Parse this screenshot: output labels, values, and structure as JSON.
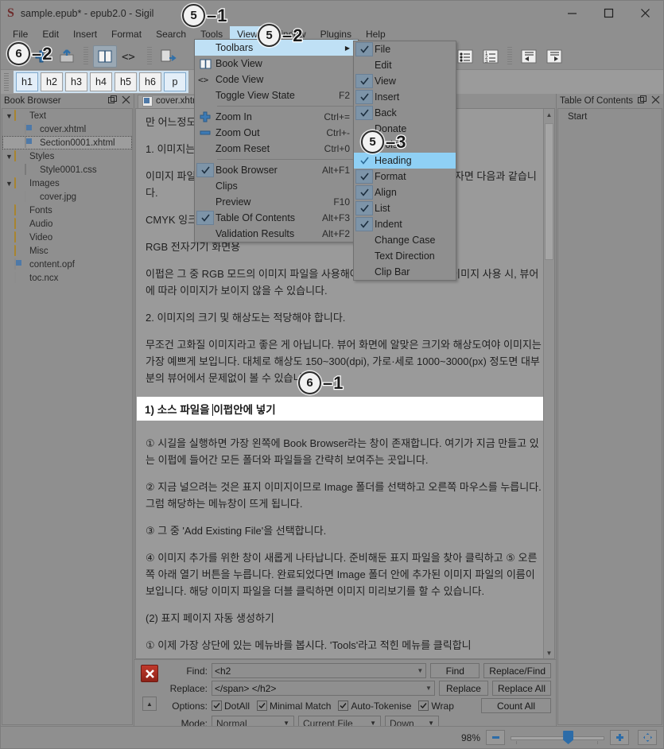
{
  "window": {
    "title": "sample.epub* - epub2.0 - Sigil",
    "logo": "S",
    "minimize": "minimize-icon",
    "maximize": "maximize-icon",
    "close": "close-icon"
  },
  "menubar": {
    "items": [
      {
        "label": "File"
      },
      {
        "label": "Edit"
      },
      {
        "label": "Insert"
      },
      {
        "label": "Format"
      },
      {
        "label": "Search"
      },
      {
        "label": "Tools"
      },
      {
        "label": "View",
        "active": true
      },
      {
        "label": "Window"
      },
      {
        "label": "Plugins"
      },
      {
        "label": "Help"
      }
    ]
  },
  "heading_toolbar": {
    "buttons": [
      "h1",
      "h2",
      "h3",
      "h4",
      "h5",
      "h6",
      "p"
    ],
    "selected": "p"
  },
  "view_menu": {
    "items": [
      {
        "label": "Toolbars",
        "submenu": true,
        "highlighted": true
      },
      {
        "label": "Book View",
        "icon": "book-icon"
      },
      {
        "label": "Code View",
        "icon": "code-icon"
      },
      {
        "label": "Toggle View State",
        "accel": "F2"
      },
      {
        "separator": true
      },
      {
        "label": "Zoom In",
        "accel": "Ctrl+=",
        "icon": "plus-icon"
      },
      {
        "label": "Zoom Out",
        "accel": "Ctrl+-",
        "icon": "minus-icon"
      },
      {
        "label": "Zoom Reset",
        "accel": "Ctrl+0"
      },
      {
        "separator": true
      },
      {
        "label": "Book Browser",
        "accel": "Alt+F1",
        "checked": true
      },
      {
        "label": "Clips"
      },
      {
        "label": "Preview",
        "accel": "F10"
      },
      {
        "label": "Table Of Contents",
        "accel": "Alt+F3",
        "checked": true
      },
      {
        "label": "Validation Results",
        "accel": "Alt+F2"
      }
    ]
  },
  "toolbars_submenu": {
    "items": [
      {
        "label": "File",
        "checked": true,
        "boxed": true
      },
      {
        "label": "Edit",
        "checked": false
      },
      {
        "label": "View",
        "checked": true
      },
      {
        "label": "Insert",
        "checked": true
      },
      {
        "label": "Back",
        "checked": true
      },
      {
        "label": "Donate",
        "checked": false
      },
      {
        "label": "Tools",
        "checked": false
      },
      {
        "label": "Heading",
        "checked": true,
        "highlighted": true
      },
      {
        "label": "Format",
        "checked": true
      },
      {
        "label": "Align",
        "checked": true
      },
      {
        "label": "List",
        "checked": true
      },
      {
        "label": "Indent",
        "checked": true
      },
      {
        "label": "Change Case",
        "checked": false
      },
      {
        "label": "Text Direction",
        "checked": false
      },
      {
        "label": "Clip Bar",
        "checked": false
      }
    ]
  },
  "book_browser": {
    "title": "Book Browser",
    "float_icon": "float-icon",
    "close_icon": "close-icon",
    "tree": [
      {
        "label": "Text",
        "type": "folder",
        "depth": 0,
        "expanded": true
      },
      {
        "label": "cover.xhtml",
        "type": "xhtml",
        "depth": 1
      },
      {
        "label": "Section0001.xhtml",
        "type": "xhtml",
        "depth": 1,
        "selected": true
      },
      {
        "label": "Styles",
        "type": "folder",
        "depth": 0,
        "expanded": true
      },
      {
        "label": "Style0001.css",
        "type": "css",
        "depth": 1
      },
      {
        "label": "Images",
        "type": "folder",
        "depth": 0,
        "expanded": true
      },
      {
        "label": "cover.jpg",
        "type": "doc",
        "depth": 1
      },
      {
        "label": "Fonts",
        "type": "folder",
        "depth": 0
      },
      {
        "label": "Audio",
        "type": "folder",
        "depth": 0
      },
      {
        "label": "Video",
        "type": "folder",
        "depth": 0
      },
      {
        "label": "Misc",
        "type": "folder",
        "depth": 0
      },
      {
        "label": "content.opf",
        "type": "xhtml",
        "depth": 0
      },
      {
        "label": "toc.ncx",
        "type": "doc",
        "depth": 0
      }
    ]
  },
  "editor": {
    "tab_label": "cover.xhtml",
    "paragraphs": [
      "만 어느정도 지켜주어야 다양한 뷰어에서 문제없이 볼 수 있습니다.",
      "1. 이미지는 RGB 모드여야 합니다.",
      "이미지 파일은 크게 RGB 모드와 CMYK 모드로 나뉩니다. 간단히 설명하자면 다음과 같습니다.",
      "CMYK 잉크를 사용하는 인쇄용",
      "RGB 전자기기 화면용",
      "이펍은 그 중 RGB 모드의 이미지 파일을 사용해야 합니다. CMYK 모드 이미지 사용 시, 뷰어에 따라 이미지가 보이지 않을 수 있습니다.",
      "2. 이미지의 크기 및 해상도는 적당해야 합니다.",
      "무조건 고화질 이미지라고 좋은 게 아닙니다. 뷰어 화면에 알맞은 크기와 해상도여야 이미지는 가장 예쁘게 보입니다. 대체로 해상도 150~300(dpi), 가로·세로 1000~3000(px) 정도면 대부분의 뷰어에서 문제없이 볼 수 있습니다."
    ],
    "heading_line_before": "1) 소스 파일을 ",
    "heading_line_after": "이펍안에 넣기",
    "paragraphs_after": [
      "① 시길을 실행하면 가장 왼쪽에 Book Browser라는 창이 존재합니다. 여기가 지금 만들고 있는 이펍에 들어간 모든 폴더와 파일들을 간략히 보여주는 곳입니다.",
      "② 지금 널으려는 것은 표지 이미지이므로 Image 폴더를 선택하고 오른쪽 마우스를 누릅니다. 그럼 해당하는 메뉴창이 뜨게 됩니다.",
      "③ 그 중 'Add Existing File'을 선택합니다.",
      "④ 이미지 추가를 위한 창이 새롭게 나타납니다. 준비해둔 표지 파일을 찾아 클릭하고 ⑤ 오른쪽 아래 열기 버튼을 누릅니다. 완료되었다면 Image 폴더 안에 추가된 이미지 파일의 이름이 보입니다. 해당 이미지 파일을 더블 클릭하면 이미지 미리보기를 할 수 있습니다.",
      "(2) 표지 페이지 자동 생성하기",
      "① 이제 가장 상단에 있는 메뉴바를 봅시다. 'Tools'라고 적힌 메뉴를 클릭합니"
    ]
  },
  "toc": {
    "title": "Table Of Contents",
    "float_icon": "float-icon",
    "close_icon": "close-icon",
    "entries": [
      "Start"
    ]
  },
  "find_replace": {
    "close_icon": "close-icon",
    "find_label": "Find:",
    "find_value": "<h2",
    "replace_label": "Replace:",
    "replace_value": "</span> </h2>",
    "options_label": "Options:",
    "options": [
      {
        "label": "DotAll",
        "checked": true
      },
      {
        "label": "Minimal Match",
        "checked": true
      },
      {
        "label": "Auto-Tokenise",
        "checked": true
      },
      {
        "label": "Wrap",
        "checked": true
      }
    ],
    "mode_label": "Mode:",
    "mode_value": "Normal",
    "scope_value": "Current File",
    "direction_value": "Down",
    "buttons": {
      "find": "Find",
      "replace_find": "Replace/Find",
      "replace": "Replace",
      "replace_all": "Replace All",
      "count_all": "Count All"
    },
    "collapse_icon": "chevron-up-icon"
  },
  "status_bar": {
    "zoom_label": "98%",
    "zoom_out_icon": "minus-icon",
    "zoom_in_icon": "plus-icon",
    "expand_icon": "expand-icon"
  },
  "annotations": [
    {
      "id": "a51",
      "circle": "5",
      "dash": "–",
      "num": "1"
    },
    {
      "id": "a52",
      "circle": "5",
      "dash": "–",
      "num": "2"
    },
    {
      "id": "a53",
      "circle": "5",
      "dash": "–",
      "num": "3"
    },
    {
      "id": "a62",
      "circle": "6",
      "dash": "–",
      "num": "2"
    },
    {
      "id": "a61",
      "circle": "6",
      "dash": "–",
      "num": "1"
    }
  ],
  "colors": {
    "chrome": "#8f8f8f",
    "menu_highlight": "#bfe0f5",
    "submenu_highlight": "#8fd0f5",
    "check_box_bg": "#7d94a8",
    "accent_blue": "#2c6ca8",
    "heading_bg": "#ffffff"
  }
}
